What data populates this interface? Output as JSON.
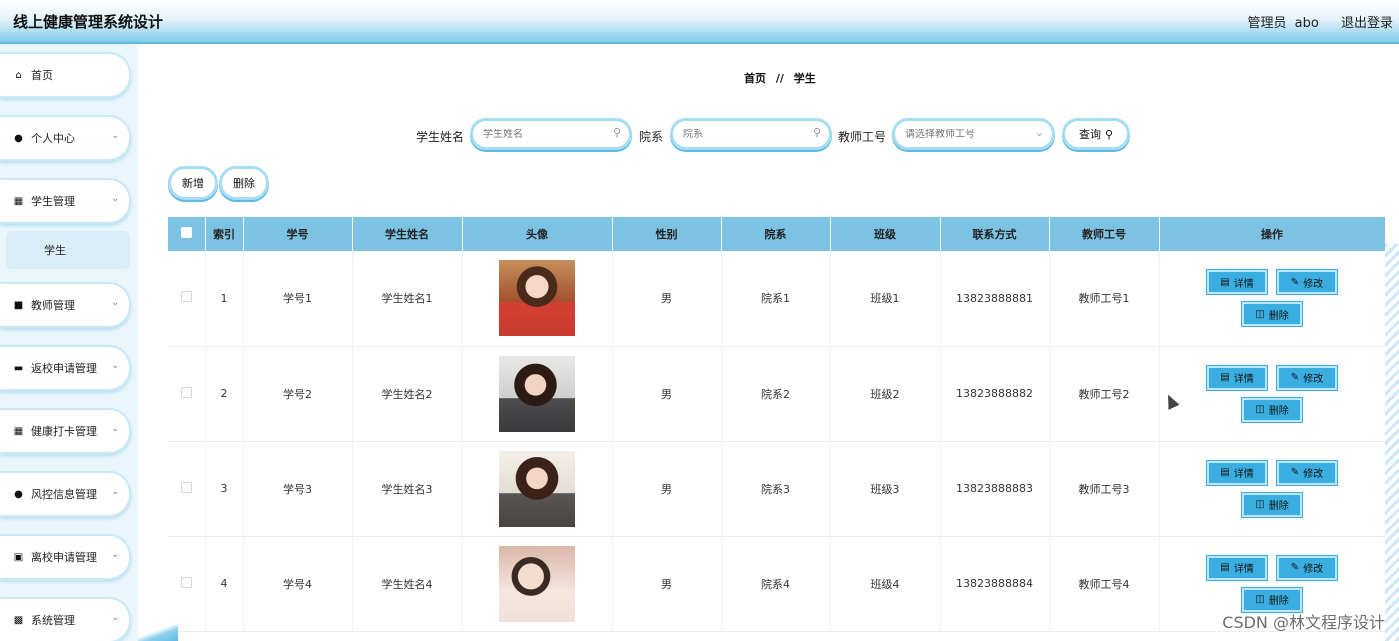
{
  "app": {
    "title": "线上健康管理系统设计",
    "user_role": "管理员",
    "user_name": "abo",
    "logout": "退出登录"
  },
  "sidebar": {
    "items": [
      {
        "label": "首页",
        "icon": "home-icon"
      },
      {
        "label": "个人中心",
        "icon": "user-icon"
      },
      {
        "label": "学生管理",
        "icon": "grid-icon"
      },
      {
        "label": "教师管理",
        "icon": "teacher-icon"
      },
      {
        "label": "返校申请管理",
        "icon": "chat-icon"
      },
      {
        "label": "健康打卡管理",
        "icon": "grid-icon"
      },
      {
        "label": "风控信息管理",
        "icon": "user-icon"
      },
      {
        "label": "离校申请管理",
        "icon": "clipboard-icon"
      },
      {
        "label": "系统管理",
        "icon": "briefcase-icon"
      }
    ],
    "sub_items": [
      {
        "label": "学生"
      }
    ]
  },
  "breadcrumb": {
    "home": "首页",
    "separator": "//",
    "current": "学生"
  },
  "search": {
    "name_label": "学生姓名",
    "name_placeholder": "学生姓名",
    "dept_label": "院系",
    "dept_placeholder": "院系",
    "teacher_label": "教师工号",
    "teacher_placeholder": "请选择教师工号",
    "query_label": "查询"
  },
  "actions": {
    "add": "新增",
    "delete": "删除"
  },
  "table": {
    "headers": [
      "索引",
      "学号",
      "学生姓名",
      "头像",
      "性别",
      "院系",
      "班级",
      "联系方式",
      "教师工号",
      "操作"
    ],
    "rows": [
      {
        "index": "1",
        "id": "学号1",
        "name": "学生姓名1",
        "gender": "男",
        "dept": "院系1",
        "class": "班级1",
        "phone": "13823888881",
        "teacher": "教师工号1"
      },
      {
        "index": "2",
        "id": "学号2",
        "name": "学生姓名2",
        "gender": "男",
        "dept": "院系2",
        "class": "班级2",
        "phone": "13823888882",
        "teacher": "教师工号2"
      },
      {
        "index": "3",
        "id": "学号3",
        "name": "学生姓名3",
        "gender": "男",
        "dept": "院系3",
        "class": "班级3",
        "phone": "13823888883",
        "teacher": "教师工号3"
      },
      {
        "index": "4",
        "id": "学号4",
        "name": "学生姓名4",
        "gender": "男",
        "dept": "院系4",
        "class": "班级4",
        "phone": "13823888884",
        "teacher": "教师工号4"
      }
    ],
    "op_detail": "详情",
    "op_edit": "修改",
    "op_delete": "删除"
  },
  "watermark": "CSDN @林文程序设计",
  "colors": {
    "accent": "#5dbbe4",
    "table_header": "#7cc3e3",
    "op_button": "#3aaee0"
  }
}
